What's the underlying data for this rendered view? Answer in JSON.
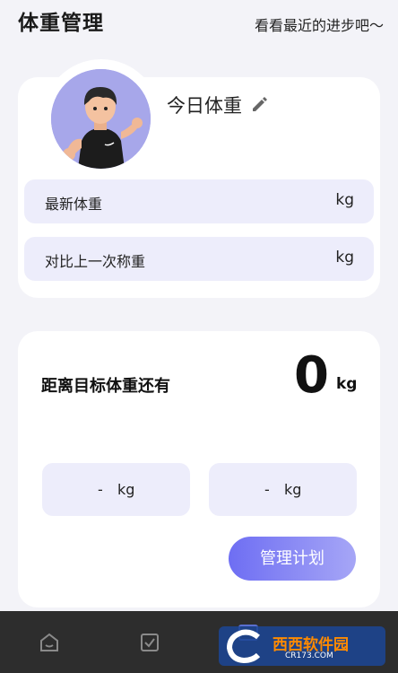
{
  "header": {
    "title": "体重管理",
    "link": "看看最近的进步吧～"
  },
  "profile": {
    "today_label": "今日体重",
    "edit_icon": "pencil-icon",
    "avatar": "runner-avatar"
  },
  "stats": [
    {
      "label": "最新体重",
      "unit": "kg"
    },
    {
      "label": "对比上一次称重",
      "unit": "kg"
    }
  ],
  "target": {
    "label": "距离目标体重还有",
    "value": "0",
    "unit": "kg"
  },
  "mini_boxes": [
    {
      "value": "-",
      "unit": "kg"
    },
    {
      "value": "-",
      "unit": "kg"
    }
  ],
  "plan_button": "管理计划",
  "tabbar": {
    "icons": [
      "home-icon",
      "check-icon",
      "calendar-icon"
    ]
  },
  "watermark": {
    "text": "西西软件园",
    "sub": "CR173.COM"
  },
  "colors": {
    "accent": "#6e6ef3",
    "card_tint": "#ededfb",
    "background": "#f3f3f8",
    "tabbar": "#2d2d2d"
  }
}
